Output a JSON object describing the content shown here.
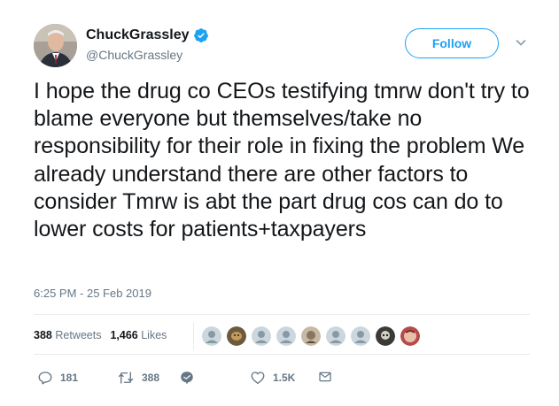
{
  "user": {
    "display_name": "ChuckGrassley",
    "handle": "@ChuckGrassley",
    "verified_icon": "verified-badge-icon"
  },
  "follow_label": "Follow",
  "tweet": {
    "text": "I hope the drug co CEOs testifying tmrw don't try to blame everyone but themselves/take no responsibility for their role in fixing the problem We already understand there are other factors to consider Tmrw is abt the part drug cos can do to lower costs for patients+taxpayers",
    "timestamp": "6:25 PM - 25 Feb 2019"
  },
  "stats": {
    "retweets_count": "388",
    "retweets_label": "Retweets",
    "likes_count": "1,466",
    "likes_label": "Likes"
  },
  "likers": [
    "default",
    "photo",
    "default",
    "default",
    "photo",
    "default",
    "default",
    "photo",
    "photo"
  ],
  "actions": {
    "replies": "181",
    "retweets": "388",
    "likes": "1.5K"
  },
  "colors": {
    "accent": "#1da1f2",
    "muted": "#657786",
    "text": "#14171a",
    "divider": "#e6ecf0"
  }
}
